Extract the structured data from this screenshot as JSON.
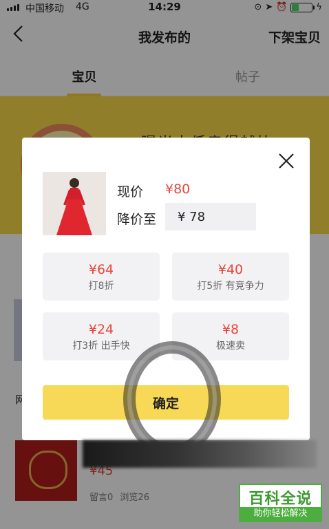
{
  "status_bar": {
    "carrier": "中国移动",
    "network": "4G",
    "time": "14:29",
    "battery_level": 0.35,
    "battery_color": "#4cd964"
  },
  "nav": {
    "title": "我发布的",
    "right_action": "下架宝贝"
  },
  "tabs": [
    {
      "label": "宝贝",
      "active": true
    },
    {
      "label": "帖子",
      "active": false
    }
  ],
  "background_page": {
    "banner_text": "曝光太低卖得越快",
    "card_label": "网",
    "item": {
      "price": "¥45",
      "comments": "留言0",
      "views": "浏览26"
    }
  },
  "modal": {
    "current_price_label": "现价",
    "current_price": "¥80",
    "reduce_to_label": "降价至",
    "reduce_to_value": "¥ 78",
    "options": [
      {
        "price": "¥64",
        "desc": "打8折"
      },
      {
        "price": "¥40",
        "desc": "打5折 有竞争力"
      },
      {
        "price": "¥24",
        "desc": "打3折 出手快"
      },
      {
        "price": "¥8",
        "desc": "极速卖"
      }
    ],
    "confirm_label": "确定"
  },
  "watermark": {
    "big": "百科全说",
    "small": "助你轻松解决"
  },
  "colors": {
    "accent_yellow": "#f7d957",
    "price_red": "#e8473a",
    "watermark_green": "#4cae3f"
  }
}
